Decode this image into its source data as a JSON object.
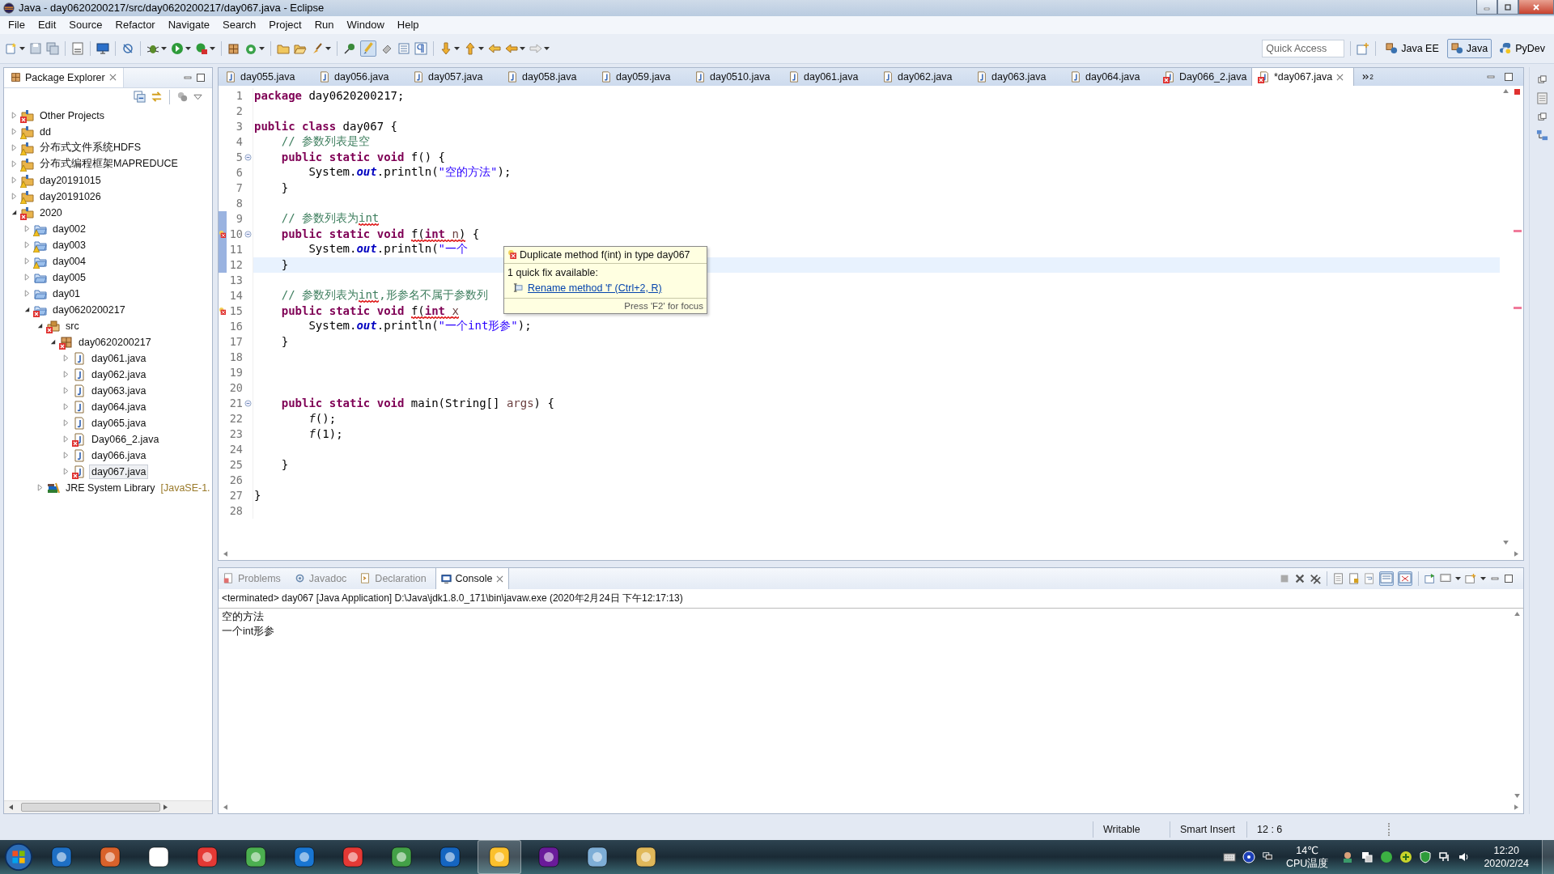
{
  "window": {
    "title": "Java - day0620200217/src/day0620200217/day067.java - Eclipse"
  },
  "menu": [
    "File",
    "Edit",
    "Source",
    "Refactor",
    "Navigate",
    "Search",
    "Project",
    "Run",
    "Window",
    "Help"
  ],
  "toolbar": {
    "quick_access": {
      "placeholder": "Quick Access"
    },
    "perspectives": [
      {
        "label": "Java EE",
        "selected": false
      },
      {
        "label": "Java",
        "selected": true
      },
      {
        "label": "PyDev",
        "selected": false
      }
    ]
  },
  "package_explorer": {
    "title": "Package Explorer",
    "tree": [
      {
        "label": "Other Projects",
        "kind": "working_set",
        "error": true,
        "warning": false,
        "expanded": false,
        "selected": false
      },
      {
        "label": "dd",
        "kind": "working_set",
        "error": false,
        "warning": true,
        "expanded": false,
        "selected": false
      },
      {
        "label": "分布式文件系统HDFS",
        "kind": "working_set",
        "error": false,
        "warning": true,
        "expanded": false,
        "selected": false
      },
      {
        "label": "分布式编程框架MAPREDUCE",
        "kind": "working_set",
        "error": false,
        "warning": true,
        "expanded": false,
        "selected": false
      },
      {
        "label": "day20191015",
        "kind": "working_set",
        "error": false,
        "warning": true,
        "expanded": false,
        "selected": false
      },
      {
        "label": "day20191026",
        "kind": "working_set",
        "error": false,
        "warning": true,
        "expanded": false,
        "selected": false
      },
      {
        "label": "2020",
        "kind": "working_set",
        "error": true,
        "warning": false,
        "expanded": true,
        "selected": false,
        "children": [
          {
            "label": "day002",
            "kind": "project",
            "error": false,
            "warning": true,
            "expanded": false,
            "selected": false
          },
          {
            "label": "day003",
            "kind": "project",
            "error": false,
            "warning": true,
            "expanded": false,
            "selected": false
          },
          {
            "label": "day004",
            "kind": "project",
            "error": false,
            "warning": true,
            "expanded": false,
            "selected": false
          },
          {
            "label": "day005",
            "kind": "project",
            "error": false,
            "warning": false,
            "expanded": false,
            "selected": false
          },
          {
            "label": "day01",
            "kind": "project",
            "error": false,
            "warning": false,
            "expanded": false,
            "selected": false
          },
          {
            "label": "day0620200217",
            "kind": "project",
            "error": true,
            "warning": false,
            "expanded": true,
            "selected": false,
            "children": [
              {
                "label": "src",
                "kind": "source_folder",
                "error": true,
                "warning": false,
                "expanded": true,
                "selected": false,
                "children": [
                  {
                    "label": "day0620200217",
                    "kind": "package",
                    "error": true,
                    "warning": false,
                    "expanded": true,
                    "selected": false,
                    "children": [
                      {
                        "label": "day061.java",
                        "kind": "java_file",
                        "error": false,
                        "warning": false,
                        "expanded": false,
                        "selected": false
                      },
                      {
                        "label": "day062.java",
                        "kind": "java_file",
                        "error": false,
                        "warning": false,
                        "expanded": false,
                        "selected": false
                      },
                      {
                        "label": "day063.java",
                        "kind": "java_file",
                        "error": false,
                        "warning": false,
                        "expanded": false,
                        "selected": false
                      },
                      {
                        "label": "day064.java",
                        "kind": "java_file",
                        "error": false,
                        "warning": false,
                        "expanded": false,
                        "selected": false
                      },
                      {
                        "label": "day065.java",
                        "kind": "java_file",
                        "error": false,
                        "warning": false,
                        "expanded": false,
                        "selected": false
                      },
                      {
                        "label": "Day066_2.java",
                        "kind": "java_file",
                        "error": true,
                        "warning": false,
                        "expanded": false,
                        "selected": false
                      },
                      {
                        "label": "day066.java",
                        "kind": "java_file",
                        "error": false,
                        "warning": false,
                        "expanded": false,
                        "selected": false
                      },
                      {
                        "label": "day067.java",
                        "kind": "java_file",
                        "error": true,
                        "warning": false,
                        "expanded": false,
                        "selected": true
                      }
                    ]
                  }
                ]
              },
              {
                "label": "JRE System Library",
                "suffix": "[JavaSE-1.",
                "kind": "library",
                "error": false,
                "warning": false,
                "expanded": false,
                "selected": false
              }
            ]
          }
        ]
      }
    ]
  },
  "editor": {
    "tabs": [
      {
        "label": "day055.java",
        "error": false,
        "selected": false
      },
      {
        "label": "day056.java",
        "error": false,
        "selected": false
      },
      {
        "label": "day057.java",
        "error": false,
        "selected": false
      },
      {
        "label": "day058.java",
        "error": false,
        "selected": false
      },
      {
        "label": "day059.java",
        "error": false,
        "selected": false
      },
      {
        "label": "day0510.java",
        "error": false,
        "selected": false
      },
      {
        "label": "day061.java",
        "error": false,
        "selected": false
      },
      {
        "label": "day062.java",
        "error": false,
        "selected": false
      },
      {
        "label": "day063.java",
        "error": false,
        "selected": false
      },
      {
        "label": "day064.java",
        "error": false,
        "selected": false
      },
      {
        "label": "Day066_2.java",
        "error": true,
        "selected": false
      },
      {
        "label": "*day067.java",
        "error": true,
        "selected": true
      }
    ],
    "more_tabs": "2",
    "lines": [
      {
        "number": "1",
        "fold": false,
        "error": false,
        "changed": false,
        "current": false,
        "tokens": [
          {
            "text": "package",
            "kind": "kw",
            "squiggle": false
          },
          {
            "text": " day0620200217;",
            "kind": "plain",
            "squiggle": false
          }
        ]
      },
      {
        "number": "2",
        "fold": false,
        "error": false,
        "changed": false,
        "current": false
      },
      {
        "number": "3",
        "fold": false,
        "error": false,
        "changed": false,
        "current": false,
        "tokens": [
          {
            "text": "public class",
            "kind": "kw",
            "squiggle": false
          },
          {
            "text": " day067 {",
            "kind": "plain",
            "squiggle": false
          }
        ]
      },
      {
        "number": "4",
        "fold": false,
        "error": false,
        "changed": false,
        "current": false,
        "tokens": [
          {
            "text": "    // 参数列表是空",
            "kind": "comment",
            "squiggle": false
          }
        ]
      },
      {
        "number": "5",
        "fold": true,
        "error": false,
        "changed": false,
        "current": false,
        "tokens": [
          {
            "text": "    public static void",
            "kind": "kw",
            "squiggle": false
          },
          {
            "text": " f() {",
            "kind": "plain",
            "squiggle": false
          }
        ]
      },
      {
        "number": "6",
        "fold": false,
        "error": false,
        "changed": false,
        "current": false,
        "tokens": [
          {
            "text": "        System.",
            "kind": "plain",
            "squiggle": false
          },
          {
            "text": "out",
            "kind": "field",
            "squiggle": false
          },
          {
            "text": ".println(",
            "kind": "plain",
            "squiggle": false
          },
          {
            "text": "\"空的方法\"",
            "kind": "string",
            "squiggle": false
          },
          {
            "text": ");",
            "kind": "plain",
            "squiggle": false
          }
        ]
      },
      {
        "number": "7",
        "fold": false,
        "error": false,
        "changed": false,
        "current": false,
        "tokens": [
          {
            "text": "    }",
            "kind": "plain",
            "squiggle": false
          }
        ]
      },
      {
        "number": "8",
        "fold": false,
        "error": false,
        "changed": false,
        "current": false
      },
      {
        "number": "9",
        "fold": false,
        "error": false,
        "changed": true,
        "current": false,
        "tokens": [
          {
            "text": "    // 参数列表为",
            "kind": "comment",
            "squiggle": false
          },
          {
            "text": "int",
            "kind": "comment",
            "squiggle": true
          }
        ]
      },
      {
        "number": "10",
        "fold": true,
        "error": true,
        "changed": true,
        "current": false,
        "tokens": [
          {
            "text": "    public static void ",
            "kind": "kw",
            "squiggle": false
          },
          {
            "text": "f(",
            "kind": "plain",
            "squiggle": true
          },
          {
            "text": "int ",
            "kind": "kw",
            "squiggle": true
          },
          {
            "text": "n",
            "kind": "var",
            "squiggle": true
          },
          {
            "text": ")",
            "kind": "plain",
            "squiggle": true
          },
          {
            "text": " {",
            "kind": "plain",
            "squiggle": false
          }
        ]
      },
      {
        "number": "11",
        "fold": false,
        "error": false,
        "changed": true,
        "current": false,
        "tokens": [
          {
            "text": "        System.",
            "kind": "plain",
            "squiggle": false
          },
          {
            "text": "out",
            "kind": "field",
            "squiggle": false
          },
          {
            "text": ".println(",
            "kind": "plain",
            "squiggle": false
          },
          {
            "text": "\"一个",
            "kind": "string",
            "squiggle": false
          }
        ]
      },
      {
        "number": "12",
        "fold": false,
        "error": false,
        "changed": true,
        "current": true,
        "tokens": [
          {
            "text": "    }",
            "kind": "plain",
            "squiggle": false
          }
        ]
      },
      {
        "number": "13",
        "fold": false,
        "error": false,
        "changed": false,
        "current": false
      },
      {
        "number": "14",
        "fold": false,
        "error": false,
        "changed": false,
        "current": false,
        "tokens": [
          {
            "text": "    // 参数列表为",
            "kind": "comment",
            "squiggle": false
          },
          {
            "text": "int",
            "kind": "comment",
            "squiggle": true
          },
          {
            "text": ",形参名不属于参数列",
            "kind": "comment",
            "squiggle": false
          }
        ]
      },
      {
        "number": "15",
        "fold": false,
        "error": true,
        "changed": false,
        "current": false,
        "tokens": [
          {
            "text": "    public static void ",
            "kind": "kw",
            "squiggle": false
          },
          {
            "text": "f(",
            "kind": "plain",
            "squiggle": true
          },
          {
            "text": "int ",
            "kind": "kw",
            "squiggle": true
          },
          {
            "text": "x",
            "kind": "var",
            "squiggle": true
          }
        ]
      },
      {
        "number": "16",
        "fold": false,
        "error": false,
        "changed": false,
        "current": false,
        "tokens": [
          {
            "text": "        System.",
            "kind": "plain",
            "squiggle": false
          },
          {
            "text": "out",
            "kind": "field",
            "squiggle": false
          },
          {
            "text": ".println(",
            "kind": "plain",
            "squiggle": false
          },
          {
            "text": "\"一个int形参\"",
            "kind": "string",
            "squiggle": false
          },
          {
            "text": ");",
            "kind": "plain",
            "squiggle": false
          }
        ]
      },
      {
        "number": "17",
        "fold": false,
        "error": false,
        "changed": false,
        "current": false,
        "tokens": [
          {
            "text": "    }",
            "kind": "plain",
            "squiggle": false
          }
        ]
      },
      {
        "number": "18",
        "fold": false,
        "error": false,
        "changed": false,
        "current": false
      },
      {
        "number": "19",
        "fold": false,
        "error": false,
        "changed": false,
        "current": false
      },
      {
        "number": "20",
        "fold": false,
        "error": false,
        "changed": false,
        "current": false
      },
      {
        "number": "21",
        "fold": true,
        "error": false,
        "changed": false,
        "current": false,
        "tokens": [
          {
            "text": "    public static void",
            "kind": "kw",
            "squiggle": false
          },
          {
            "text": " main(String[] ",
            "kind": "plain",
            "squiggle": false
          },
          {
            "text": "args",
            "kind": "var",
            "squiggle": false
          },
          {
            "text": ") {",
            "kind": "plain",
            "squiggle": false
          }
        ]
      },
      {
        "number": "22",
        "fold": false,
        "error": false,
        "changed": false,
        "current": false,
        "tokens": [
          {
            "text": "        f",
            "kind": "call",
            "squiggle": false
          },
          {
            "text": "();",
            "kind": "plain",
            "squiggle": false
          }
        ]
      },
      {
        "number": "23",
        "fold": false,
        "error": false,
        "changed": false,
        "current": false,
        "tokens": [
          {
            "text": "        f",
            "kind": "call",
            "squiggle": false
          },
          {
            "text": "(1);",
            "kind": "plain",
            "squiggle": false
          }
        ]
      },
      {
        "number": "24",
        "fold": false,
        "error": false,
        "changed": false,
        "current": false
      },
      {
        "number": "25",
        "fold": false,
        "error": false,
        "changed": false,
        "current": false,
        "tokens": [
          {
            "text": "    }",
            "kind": "plain",
            "squiggle": false
          }
        ]
      },
      {
        "number": "26",
        "fold": false,
        "error": false,
        "changed": false,
        "current": false
      },
      {
        "number": "27",
        "fold": false,
        "error": false,
        "changed": false,
        "current": false,
        "tokens": [
          {
            "text": "}",
            "kind": "plain",
            "squiggle": false
          }
        ]
      },
      {
        "number": "28",
        "fold": false,
        "error": false,
        "changed": false,
        "current": false
      }
    ],
    "hover": {
      "title": "Duplicate method f(int) in type day067",
      "subtitle": "1 quick fix available:",
      "fix": "Rename method 'f' (Ctrl+2, R)",
      "footer": "Press 'F2' for focus"
    }
  },
  "console": {
    "tabs": [
      {
        "label": "Problems",
        "kind": "problems",
        "selected": false
      },
      {
        "label": "Javadoc",
        "kind": "javadoc",
        "selected": false
      },
      {
        "label": "Declaration",
        "kind": "declaration",
        "selected": false
      },
      {
        "label": "Console",
        "kind": "console",
        "selected": true
      }
    ],
    "header": "<terminated> day067 [Java Application] D:\\Java\\jdk1.8.0_171\\bin\\javaw.exe (2020年2月24日 下午12:17:13)",
    "output": [
      "空的方法",
      "一个int形参"
    ]
  },
  "status_bar": [
    "Writable",
    "Smart Insert",
    "12 : 6"
  ],
  "taskbar": {
    "temperature": "14℃",
    "temperature_label": "CPU温度",
    "time": "12:20",
    "date": "2020/2/24"
  }
}
